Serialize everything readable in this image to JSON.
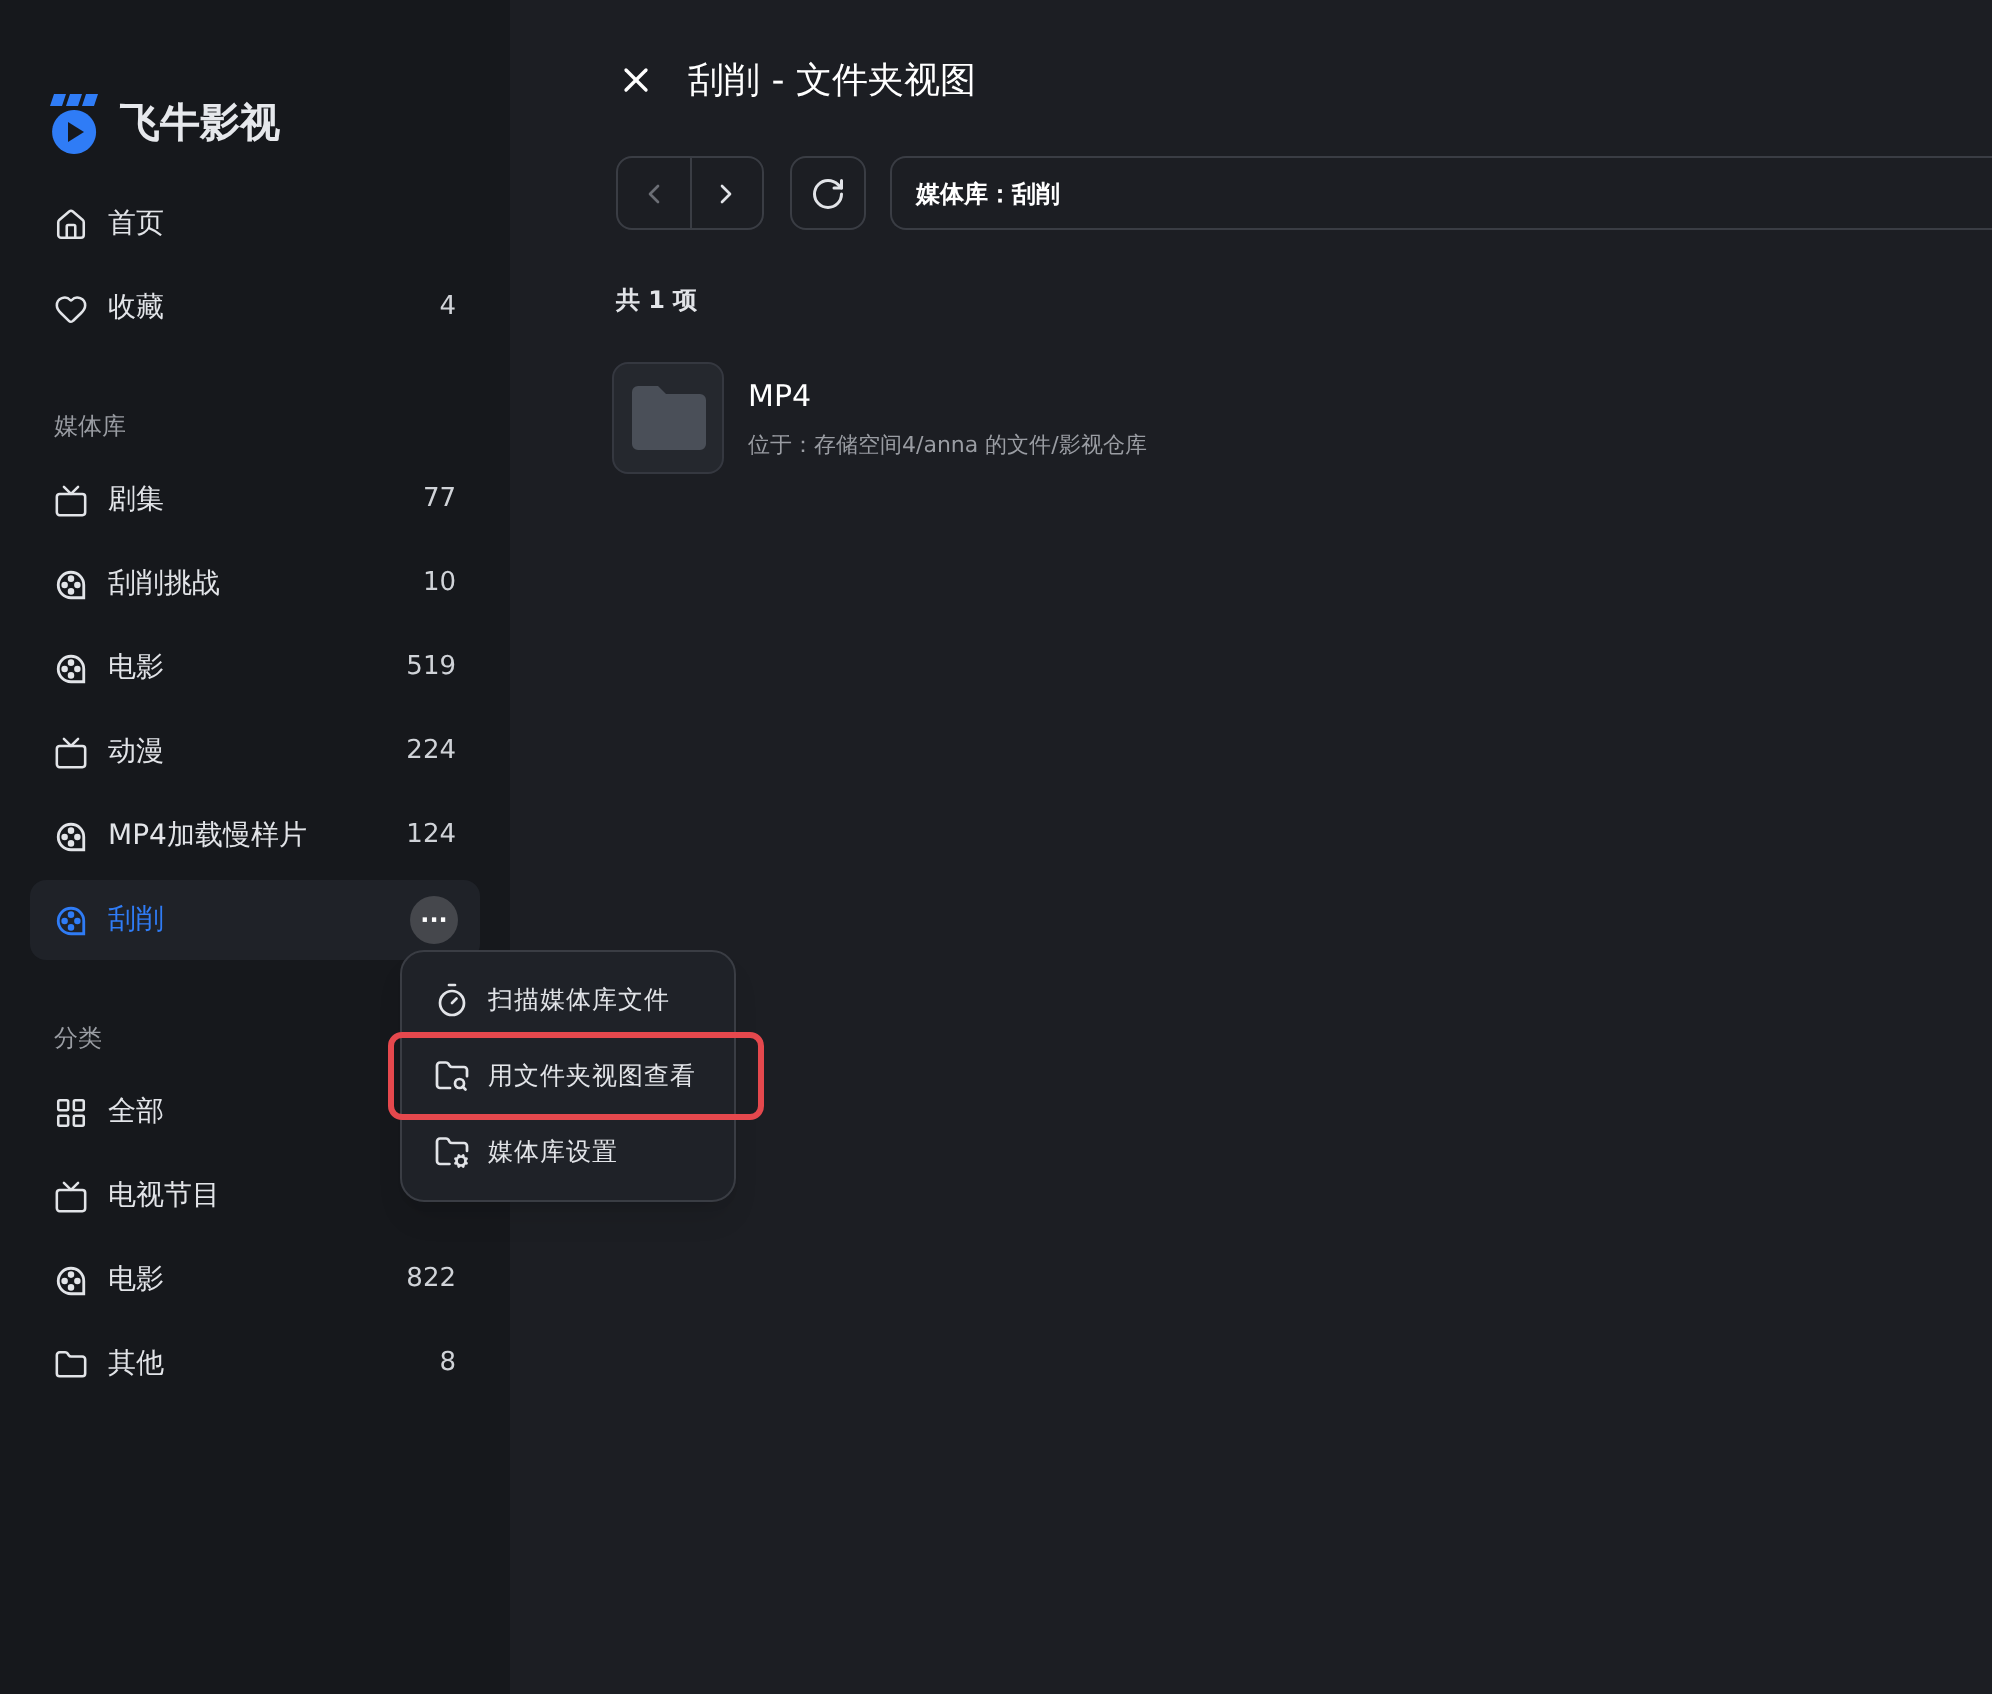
{
  "app": {
    "name": "飞牛影视"
  },
  "sidebar": {
    "top_items": [
      {
        "kind": "home",
        "label": "首页",
        "selected": false
      },
      {
        "kind": "heart",
        "label": "收藏",
        "count": "4",
        "selected": false
      }
    ],
    "sections": [
      {
        "title": "媒体库",
        "items": [
          {
            "kind": "tv",
            "label": "剧集",
            "count": "77",
            "selected": false
          },
          {
            "kind": "reel",
            "label": "刮削挑战",
            "count": "10",
            "selected": false
          },
          {
            "kind": "reel",
            "label": "电影",
            "count": "519",
            "selected": false
          },
          {
            "kind": "tv",
            "label": "动漫",
            "count": "224",
            "selected": false
          },
          {
            "kind": "reel",
            "label": "MP4加载慢样片",
            "count": "124",
            "selected": false
          },
          {
            "kind": "reel",
            "label": "刮削",
            "selected": true,
            "more_button": "···"
          }
        ]
      },
      {
        "title": "分类",
        "items": [
          {
            "kind": "grid",
            "label": "全部",
            "selected": false
          },
          {
            "kind": "tv",
            "label": "电视节目",
            "selected": false
          },
          {
            "kind": "reel",
            "label": "电影",
            "count": "822",
            "selected": false
          },
          {
            "kind": "folder",
            "label": "其他",
            "count": "8",
            "selected": false
          }
        ]
      }
    ]
  },
  "context_menu": {
    "items": [
      {
        "kind": "scan",
        "label": "扫描媒体库文件",
        "highlighted": false
      },
      {
        "kind": "folder-search",
        "label": "用文件夹视图查看",
        "highlighted": true
      },
      {
        "kind": "folder-gear",
        "label": "媒体库设置",
        "highlighted": false
      }
    ]
  },
  "main": {
    "title": "刮削 - 文件夹视图",
    "path": "媒体库：刮削",
    "count": "共 1 项",
    "items": [
      {
        "name": "MP4",
        "location": "位于：存储空间4/anna 的文件/影视仓库"
      }
    ]
  }
}
